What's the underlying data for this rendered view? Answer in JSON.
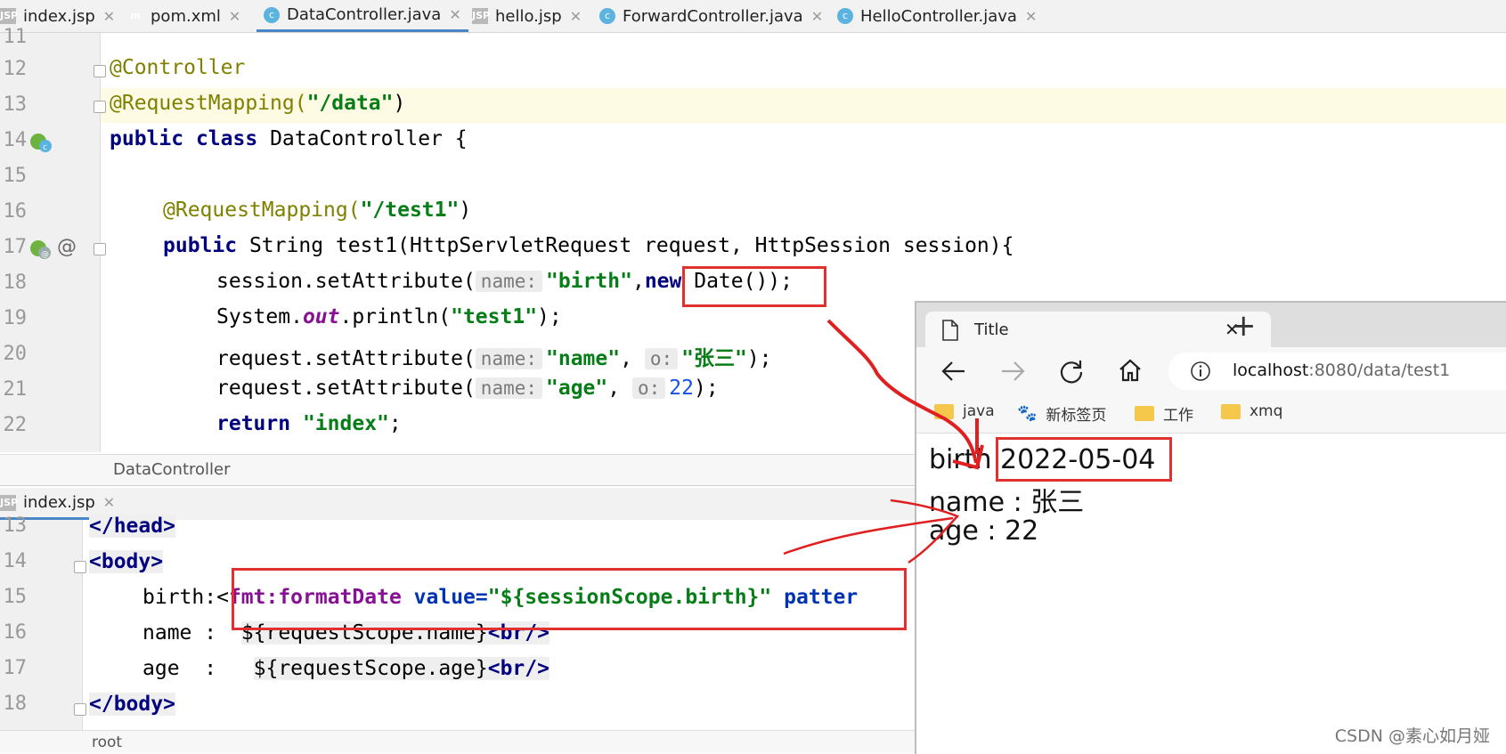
{
  "editor_tabs": [
    {
      "label": "index.jsp",
      "icon": "jsp-file-icon"
    },
    {
      "label": "pom.xml",
      "icon": "maven-icon"
    },
    {
      "label": "DataController.java",
      "icon": "java-class-icon",
      "active": true
    },
    {
      "label": "hello.jsp",
      "icon": "jsp-file-icon"
    },
    {
      "label": "ForwardController.java",
      "icon": "java-class-icon"
    },
    {
      "label": "HelloController.java",
      "icon": "java-class-icon"
    }
  ],
  "top_editor": {
    "line_numbers": [
      "11",
      "12",
      "13",
      "14",
      "15",
      "16",
      "17",
      "18",
      "19",
      "20",
      "21",
      "22"
    ],
    "lines": {
      "l12_ann": "@Controller",
      "l13_ann": "@RequestMapping(",
      "l13_str": "\"/data\"",
      "l13_end": ")",
      "l14_kw1": "public",
      "l14_kw2": "class",
      "l14_rest": "DataController {",
      "l16_ann": "@RequestMapping(",
      "l16_str": "\"/test1\"",
      "l16_end": ")",
      "l17_kw": "public",
      "l17_rest": "String test1(HttpServletRequest request, HttpSession session){",
      "l18_a": "session.setAttribute(",
      "l18_hint": "name:",
      "l18_str": "\"birth\"",
      "l18_comma": ",",
      "l18_kw": "new",
      "l18_b": "Date());",
      "l19_a": "System.",
      "l19_it": "out",
      "l19_b": ".println(",
      "l19_str": "\"test1\"",
      "l19_c": ");",
      "l20_a": "request.setAttribute(",
      "l20_hint1": "name:",
      "l20_str1": "\"name\"",
      "l20_comma": ",",
      "l20_hint2": "o:",
      "l20_str2": "\"张三\"",
      "l20_end": ");",
      "l21_a": "request.setAttribute(",
      "l21_hint1": "name:",
      "l21_str": "\"age\"",
      "l21_comma": ",",
      "l21_hint2": "o:",
      "l21_num": "22",
      "l21_end": ");",
      "l22_kw": "return",
      "l22_str": "\"index\"",
      "l22_end": ";"
    },
    "breadcrumb": "DataController"
  },
  "bottom_tab": {
    "label": "index.jsp",
    "icon": "jsp-file-icon"
  },
  "bottom_editor": {
    "line_numbers": [
      "13",
      "14",
      "15",
      "16",
      "17",
      "18"
    ],
    "lines": {
      "l13": "</head>",
      "l14": "<body>",
      "l15_a": "birth:<",
      "l15_tag": "fmt:formatDate",
      "l15_attr": "value=",
      "l15_val": "\"${sessionScope.birth}\"",
      "l15_attr2": "patter",
      "l16_a": "name :  ",
      "l16_el": "${requestScope.name}",
      "l16_br": "<br/>",
      "l17_a": "age  :   ",
      "l17_el": "${requestScope.age}",
      "l17_br": "<br/>",
      "l18": "</body>"
    },
    "breadcrumb": "root"
  },
  "browser": {
    "tab_title": "Title",
    "url_host": "localhost",
    "url_rest": ":8080/data/test1",
    "bookmarks": [
      "java",
      "新标签页",
      "工作",
      "xmq"
    ],
    "output": {
      "birth_label": "birth",
      "birth_value": "2022-05-04",
      "name_line": "name : 张三",
      "age_line": "age : 22"
    }
  },
  "watermark": "CSDN @素心如月娅",
  "colors": {
    "annotation_red": "#e03030",
    "keyword": "#00007f",
    "string": "#067d17"
  }
}
